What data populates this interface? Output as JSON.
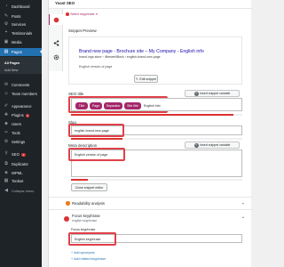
{
  "sidebar": {
    "items": [
      {
        "label": "Dashboard",
        "icon": "dashboard-icon",
        "glyph": "◔"
      },
      {
        "label": "Posts",
        "icon": "pin-icon",
        "glyph": "✎"
      },
      {
        "label": "Services",
        "icon": "services-icon",
        "glyph": "⚙"
      },
      {
        "label": "Testimonials",
        "icon": "testimonials-icon",
        "glyph": "❝"
      },
      {
        "label": "Media",
        "icon": "media-icon",
        "glyph": "▣"
      },
      {
        "label": "Pages",
        "icon": "pages-icon",
        "glyph": "▤"
      },
      {
        "label": "Comments",
        "icon": "comments-icon",
        "glyph": "✉"
      },
      {
        "label": "Team members",
        "icon": "team-icon",
        "glyph": "☺"
      },
      {
        "label": "Appearance",
        "icon": "appearance-icon",
        "glyph": "✐"
      },
      {
        "label": "Plugins",
        "icon": "plugins-icon",
        "glyph": "✚",
        "badge": "1"
      },
      {
        "label": "Users",
        "icon": "users-icon",
        "glyph": "☻"
      },
      {
        "label": "Tools",
        "icon": "tools-icon",
        "glyph": "✂"
      },
      {
        "label": "Settings",
        "icon": "settings-icon",
        "glyph": "⚙"
      },
      {
        "label": "SEO",
        "icon": "yoast-icon",
        "glyph": "Ÿ",
        "badge": "1"
      },
      {
        "label": "Duplicator",
        "icon": "duplicator-icon",
        "glyph": "⧉"
      },
      {
        "label": "WPML",
        "icon": "wpml-icon",
        "glyph": "◈"
      },
      {
        "label": "Toolset",
        "icon": "toolset-icon",
        "glyph": "▦"
      }
    ],
    "submenu": [
      {
        "label": "All Pages"
      },
      {
        "label": "Add New"
      }
    ],
    "collapse_label": "Collapse menu"
  },
  "panel": {
    "title": "Yoast SEO",
    "focus_keyphrase_label": "Select keyphrase",
    "snippet_preview_title": "Snippet Preview",
    "google_preview": {
      "title": "Brand new page - Brochure site – My Company - English info",
      "url": "brand.orgs.store › ›BeeweNBeck › english-brand-new-page",
      "description": "English version of page"
    },
    "edit_snippet_label": "Edit snippet",
    "seo_title_label": "SEO title",
    "insert_variable_label": "Insert snippet variable",
    "seo_title_tokens": [
      "Title",
      "Page",
      "Separator",
      "Site title"
    ],
    "seo_title_text": "English info",
    "slug_label": "Slug",
    "slug_value": "english-brand-new-page",
    "meta_label": "Meta description",
    "meta_value": "English version of page",
    "close_editor_label": "Close snippet editor",
    "readability_label": "Readability analysis",
    "focus_keyphrase_title": "Focus keyphrase",
    "focus_keyphrase_sub": "english keyphrase",
    "focus_field_label": "Focus keyphrase",
    "focus_field_value": "English keyphrase",
    "add_synonyms_label": "Add synonyms",
    "add_related_label": "Add related keyphrase",
    "progress": {
      "seo_title": 0.95,
      "slug": 0.3,
      "meta": 0.1
    },
    "colors": {
      "yoast_purple": "#a4286a",
      "alert_red": "#e04049",
      "wp_blue": "#2271b1",
      "bad_red": "#dc3232",
      "ok_orange": "#ee7c1b"
    }
  }
}
